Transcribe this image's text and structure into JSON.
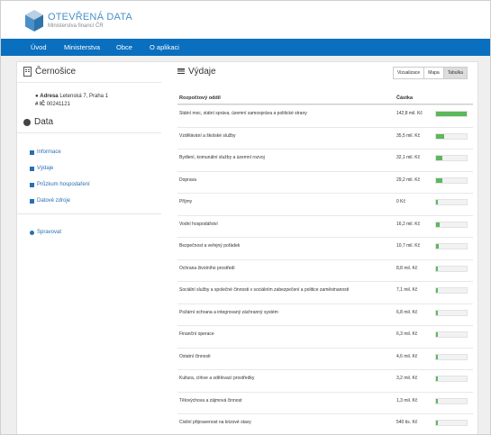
{
  "brand": {
    "title": "OTEVŘENÁ DATA",
    "subtitle": "Ministerstva financí ČR"
  },
  "nav": [
    "Úvod",
    "Ministerstva",
    "Obce",
    "O aplikaci"
  ],
  "municipality": {
    "name": "Černošice",
    "address_label": "Adresa",
    "address": "Letenská 7, Praha 1",
    "ic_label": "IČ",
    "ic": "00241121"
  },
  "data_section": {
    "title": "Data",
    "links": [
      "Informace",
      "Výdaje",
      "Průzkum hospodaření",
      "Datové zdroje"
    ],
    "admin": "Spravovat"
  },
  "expenses": {
    "title": "Výdaje",
    "view_buttons": [
      "Vizualizace",
      "Mapa",
      "Tabulka"
    ],
    "active_view": "Tabulka",
    "columns": [
      "Rozpočtový oddíl",
      "Částka"
    ],
    "bar_color": "#5cb85c",
    "rows": [
      {
        "name": "Státní moc, státní správa, územní samospráva a politické strany",
        "amount": "142,8 mil. Kč",
        "fraction": 1.0
      },
      {
        "name": "Vzdělávání a školské služby",
        "amount": "35,5 mil. Kč",
        "fraction": 0.25
      },
      {
        "name": "Bydlení, komunální služby a územní rozvoj",
        "amount": "32,1 mil. Kč",
        "fraction": 0.22
      },
      {
        "name": "Doprava",
        "amount": "29,2 mil. Kč",
        "fraction": 0.2
      },
      {
        "name": "Příjmy",
        "amount": "0 Kč",
        "fraction": 0.02
      },
      {
        "name": "Vodní hospodářství",
        "amount": "16,2 mil. Kč",
        "fraction": 0.11
      },
      {
        "name": "Bezpečnost a veřejný pořádek",
        "amount": "10,7 mil. Kč",
        "fraction": 0.075
      },
      {
        "name": "Ochrana životního prostředí",
        "amount": "8,8 mil. Kč",
        "fraction": 0.06
      },
      {
        "name": "Sociální služby a společné činnosti v sociálním zabezpečení a politice zaměstnanosti",
        "amount": "7,1 mil. Kč",
        "fraction": 0.05
      },
      {
        "name": "Požární ochrana a integrovaný záchranný systém",
        "amount": "6,8 mil. Kč",
        "fraction": 0.048
      },
      {
        "name": "Finanční operace",
        "amount": "6,3 mil. Kč",
        "fraction": 0.044
      },
      {
        "name": "Ostatní činnosti",
        "amount": "4,6 mil. Kč",
        "fraction": 0.032
      },
      {
        "name": "Kultura, církve a sdělovací prostředky",
        "amount": "3,2 mil. Kč",
        "fraction": 0.022
      },
      {
        "name": "Tělovýchova a zájmová činnost",
        "amount": "1,3 mil. Kč",
        "fraction": 0.009
      },
      {
        "name": "Civilní připravenost na krizové stavy",
        "amount": "540 tis. Kč",
        "fraction": 0.004
      }
    ]
  }
}
